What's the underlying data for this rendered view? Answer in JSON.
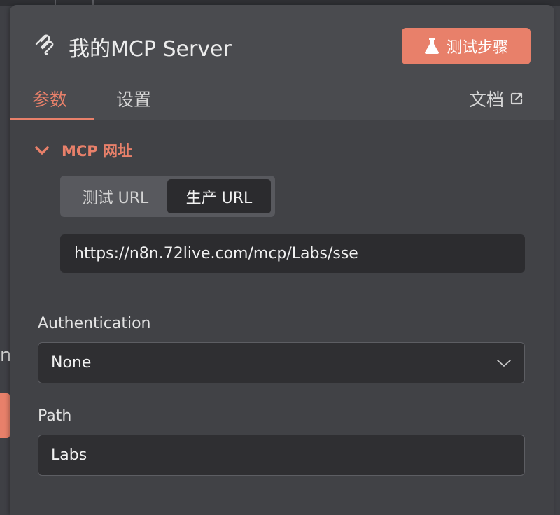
{
  "background": {
    "partial_text": "n"
  },
  "panel": {
    "title": "我的MCP Server",
    "title_icon": "mcp-logo-icon",
    "test_button": {
      "label": "测试步骤",
      "icon": "flask-icon",
      "color": "#e8806a"
    },
    "tabs": [
      {
        "label": "参数",
        "active": true
      },
      {
        "label": "设置",
        "active": false
      }
    ],
    "docs_link": {
      "label": "文档",
      "icon": "external-link-icon"
    }
  },
  "mcp_section": {
    "title": "MCP 网址",
    "expanded": true,
    "url_toggle": {
      "options": [
        "测试 URL",
        "生产 URL"
      ],
      "selected": "生产 URL"
    },
    "url_value": "https://n8n.72live.com/mcp/Labs/sse"
  },
  "authentication": {
    "label": "Authentication",
    "value": "None"
  },
  "path": {
    "label": "Path",
    "value": "Labs"
  },
  "colors": {
    "accent": "#e8806a",
    "panel_bg": "#414246",
    "header_bg": "#4a4b4f",
    "input_bg": "#2f2f32"
  }
}
